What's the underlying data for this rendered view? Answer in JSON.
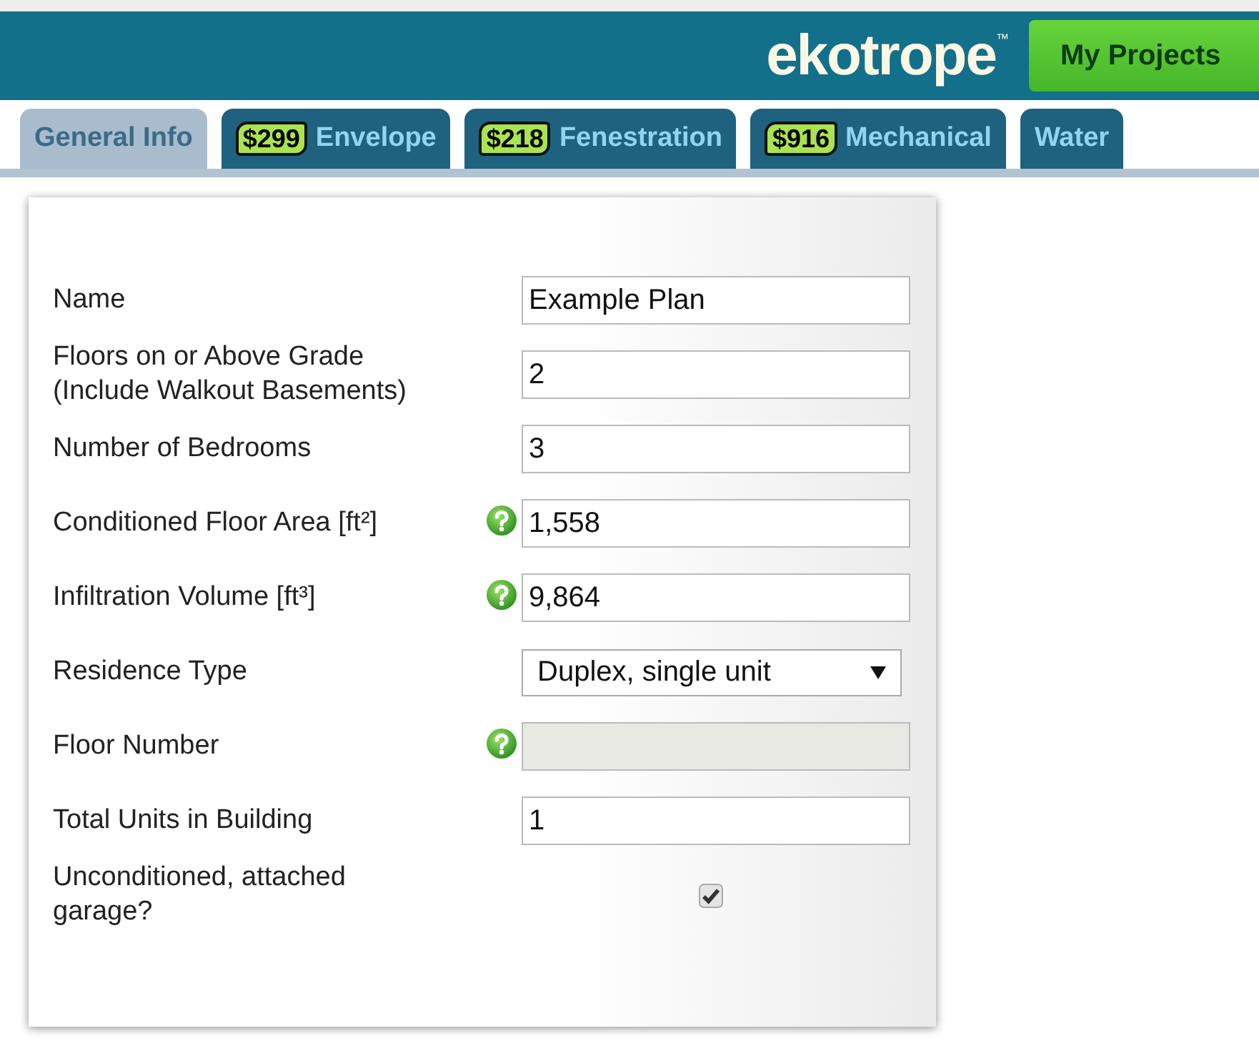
{
  "header": {
    "logo": "ekotrope",
    "trademark": "™",
    "nav_button": "My Projects"
  },
  "tabs": [
    {
      "label": "General Info",
      "selected": true
    },
    {
      "label": "Envelope",
      "badge": "$299",
      "selected": false
    },
    {
      "label": "Fenestration",
      "badge": "$218",
      "selected": false
    },
    {
      "label": "Mechanical",
      "badge": "$916",
      "selected": false
    },
    {
      "label": "Water",
      "selected": false
    }
  ],
  "form": {
    "rows": [
      {
        "kind": "text",
        "label": "Name",
        "help": false,
        "value": "Example Plan"
      },
      {
        "kind": "text",
        "label": "Floors on or Above Grade (Include Walkout Basements)",
        "help": false,
        "value": "2"
      },
      {
        "kind": "text",
        "label": "Number of Bedrooms",
        "help": false,
        "value": "3"
      },
      {
        "kind": "text",
        "label": "Conditioned Floor Area [ft²]",
        "help": true,
        "value": "1,558"
      },
      {
        "kind": "text",
        "label": "Infiltration Volume [ft³]",
        "help": true,
        "value": "9,864"
      },
      {
        "kind": "select",
        "label": "Residence Type",
        "help": false,
        "value": "Duplex, single unit"
      },
      {
        "kind": "text",
        "label": "Floor Number",
        "help": true,
        "disabled": true
      },
      {
        "kind": "text",
        "label": "Total Units in Building",
        "help": false,
        "value": "1"
      },
      {
        "kind": "checkbox",
        "label": "Unconditioned, attached garage?",
        "help": false,
        "checked": true
      }
    ]
  }
}
